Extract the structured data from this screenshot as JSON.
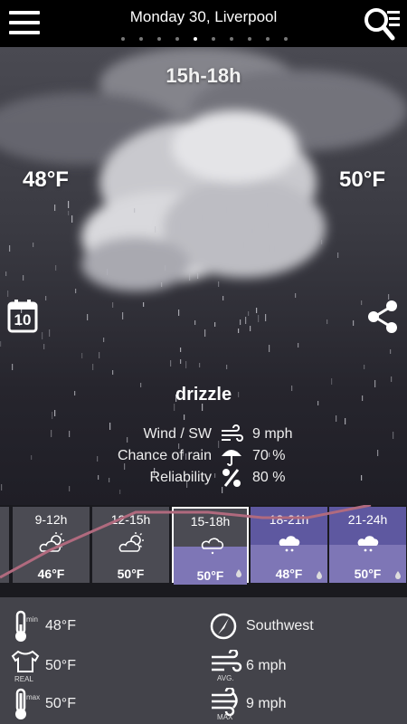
{
  "header": {
    "title": "Monday 30, Liverpool",
    "page_count": 10,
    "active_page": 4
  },
  "sky": {
    "time_range": "15h-18h",
    "temp_start": "48°F",
    "temp_end": "50°F",
    "calendar_day": "10",
    "condition": "drizzle"
  },
  "details": {
    "wind_label": "Wind / SW",
    "wind_value": "9 mph",
    "rain_label": "Chance of rain",
    "rain_value": "70 %",
    "reliability_label": "Reliability",
    "reliability_value": "80 %"
  },
  "hourly": [
    {
      "time": "9-12h",
      "temp": "46°F",
      "icon": "sun-cloud-icon",
      "selected": false,
      "rain": false
    },
    {
      "time": "12-15h",
      "temp": "50°F",
      "icon": "sun-cloud-icon",
      "selected": false,
      "rain": false
    },
    {
      "time": "15-18h",
      "temp": "50°F",
      "icon": "drizzle-icon",
      "selected": true,
      "rain": true
    },
    {
      "time": "18-21h",
      "temp": "48°F",
      "icon": "rain-icon",
      "selected": false,
      "rain": true
    },
    {
      "time": "21-24h",
      "temp": "50°F",
      "icon": "rain-icon",
      "selected": false,
      "rain": true
    }
  ],
  "stats": {
    "min_label": "min",
    "min_temp": "48°F",
    "real_label": "REAL",
    "real_temp": "50°F",
    "max_label": "max",
    "max_temp": "50°F",
    "direction": "Southwest",
    "avg_label": "AVG.",
    "avg_wind": "6 mph",
    "max_wind_label": "MAX",
    "max_wind": "9 mph"
  },
  "colors": {
    "header_bg": "#000000",
    "strip_bg": "#1a1a1f",
    "panel_bg": "#43434a",
    "rain_accent": "#7e76b6",
    "trend_line": "#b06a7e"
  }
}
